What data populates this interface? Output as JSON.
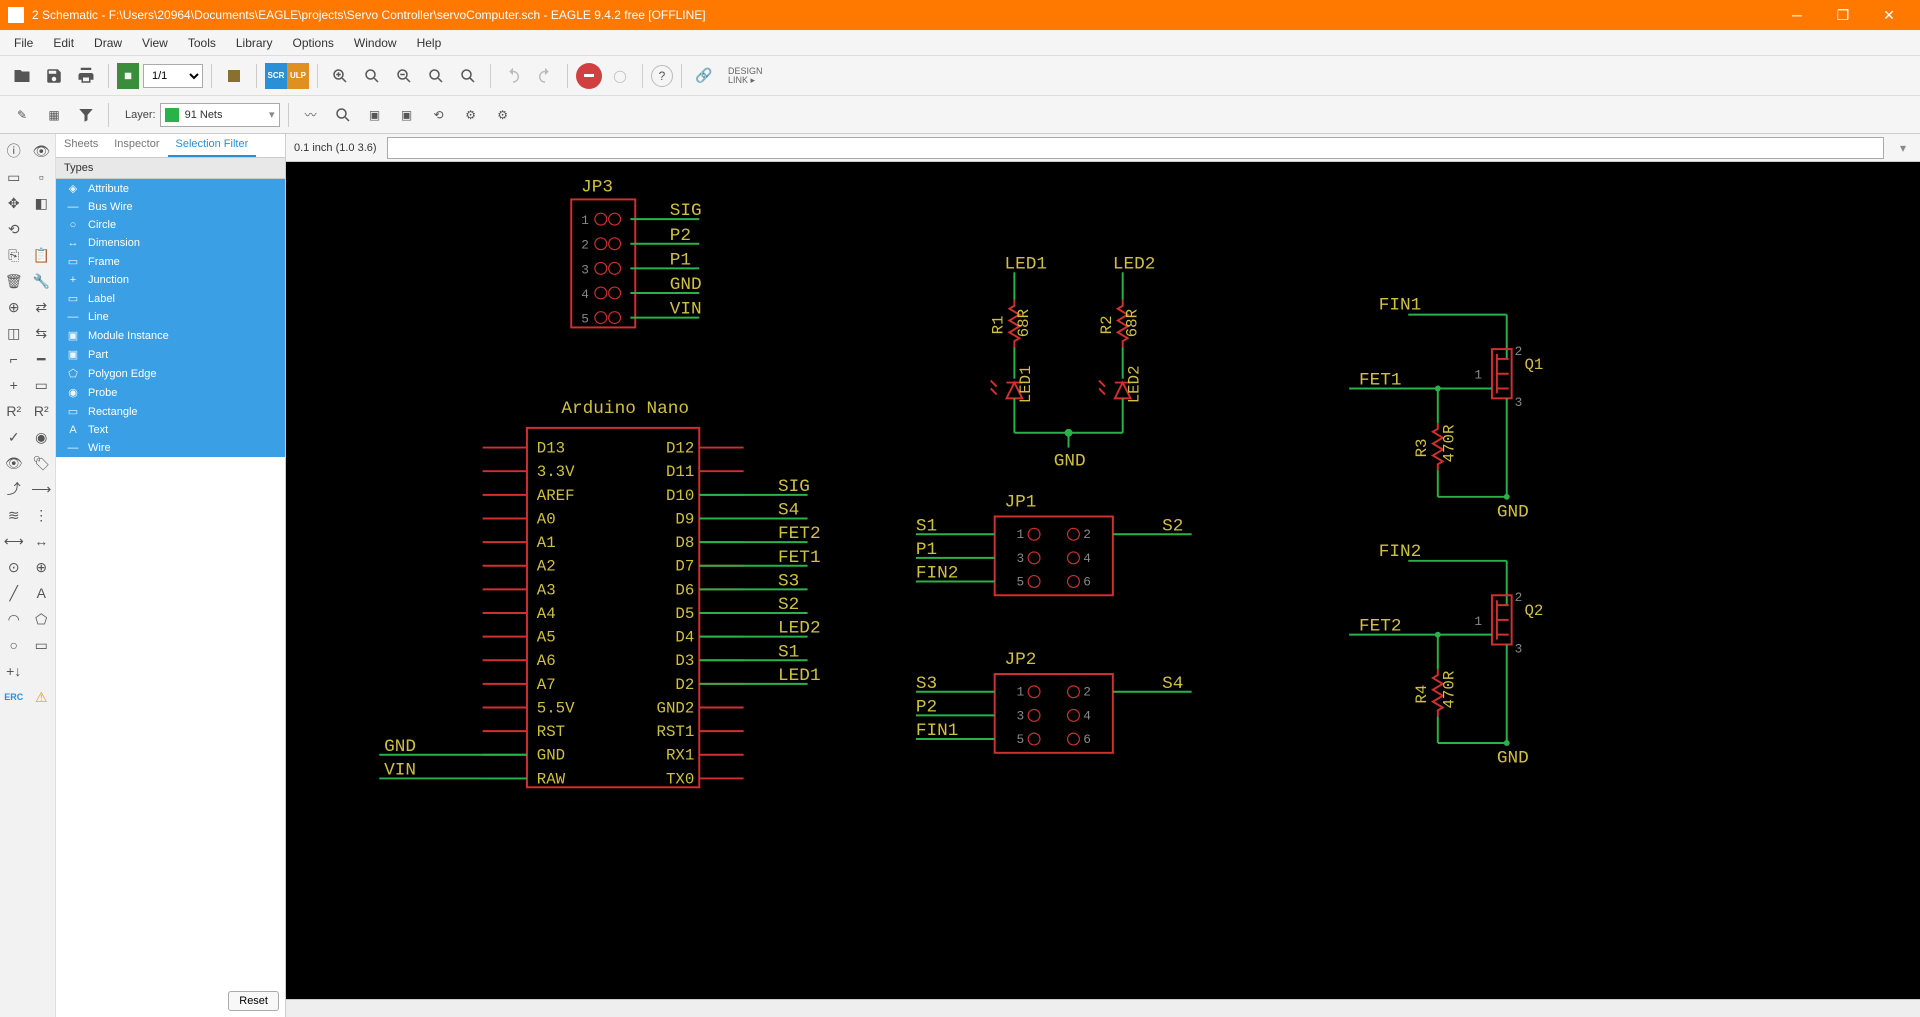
{
  "titlebar": {
    "title": "2 Schematic - F:\\Users\\20964\\Documents\\EAGLE\\projects\\Servo Controller\\servoComputer.sch - EAGLE 9.4.2 free [OFFLINE]"
  },
  "menu": [
    "File",
    "Edit",
    "Draw",
    "View",
    "Tools",
    "Library",
    "Options",
    "Window",
    "Help"
  ],
  "toolbar": {
    "sheet": "1/1",
    "sch_label": "SCH",
    "brd_label": "BRD",
    "scr_label": "SCR",
    "ulp_label": "ULP",
    "design_link": "DESIGN\nLINK ▸"
  },
  "toolbar2": {
    "layer_label": "Layer:",
    "layer_value": "91 Nets"
  },
  "panel": {
    "tabs": [
      "Sheets",
      "Inspector",
      "Selection Filter"
    ],
    "active_tab": 2,
    "header": "Types",
    "types": [
      "Attribute",
      "Bus Wire",
      "Circle",
      "Dimension",
      "Frame",
      "Junction",
      "Label",
      "Line",
      "Module Instance",
      "Part",
      "Polygon Edge",
      "Probe",
      "Rectangle",
      "Text",
      "Wire"
    ],
    "reset": "Reset"
  },
  "canvas": {
    "coords": "0.1 inch (1.0 3.6)",
    "cmd_value": ""
  },
  "schematic": {
    "arduino_title": "Arduino Nano",
    "jp3": {
      "name": "JP3",
      "pins": [
        "1",
        "2",
        "3",
        "4",
        "5"
      ],
      "nets": [
        "SIG",
        "P2",
        "P1",
        "GND",
        "VIN"
      ]
    },
    "arduino_left": [
      "D13",
      "3.3V",
      "AREF",
      "A0",
      "A1",
      "A2",
      "A3",
      "A4",
      "A5",
      "A6",
      "A7",
      "5.5V",
      "RST",
      "GND",
      "RAW"
    ],
    "arduino_right": [
      "D12",
      "D11",
      "D10",
      "D9",
      "D8",
      "D7",
      "D6",
      "D5",
      "D4",
      "D3",
      "D2",
      "GND2",
      "RST1",
      "RX1",
      "TX0"
    ],
    "arduino_nets_right": [
      "",
      "",
      "SIG",
      "S4",
      "FET2",
      "FET1",
      "S3",
      "S2",
      "LED2",
      "S1",
      "LED1",
      "",
      "",
      "",
      ""
    ],
    "arduino_nets_left_bottom": [
      "GND",
      "VIN"
    ],
    "led_block": {
      "r1": "R1",
      "r2": "R2",
      "rval": "68R",
      "led1": "LED1",
      "led2": "LED2",
      "gnd": "GND",
      "top1": "LED1",
      "top2": "LED2"
    },
    "jp1": {
      "name": "JP1",
      "left": [
        "S1",
        "P1",
        "FIN2"
      ],
      "right": [
        "S2",
        "",
        ""
      ],
      "nums_l": [
        "1",
        "3",
        "5"
      ],
      "nums_r": [
        "2",
        "4",
        "6"
      ]
    },
    "jp2": {
      "name": "JP2",
      "left": [
        "S3",
        "P2",
        "FIN1"
      ],
      "right": [
        "S4",
        "",
        ""
      ],
      "nums_l": [
        "1",
        "3",
        "5"
      ],
      "nums_r": [
        "2",
        "4",
        "6"
      ]
    },
    "fin1": {
      "name": "FIN1",
      "fet": "FET1",
      "q": "Q1",
      "r": "R3",
      "rval": "470R",
      "gnd": "GND",
      "pin1": "1",
      "pin2": "2",
      "pin3": "3"
    },
    "fin2": {
      "name": "FIN2",
      "fet": "FET2",
      "q": "Q2",
      "r": "R4",
      "rval": "470R",
      "gnd": "GND",
      "pin1": "1",
      "pin2": "2",
      "pin3": "3"
    }
  }
}
